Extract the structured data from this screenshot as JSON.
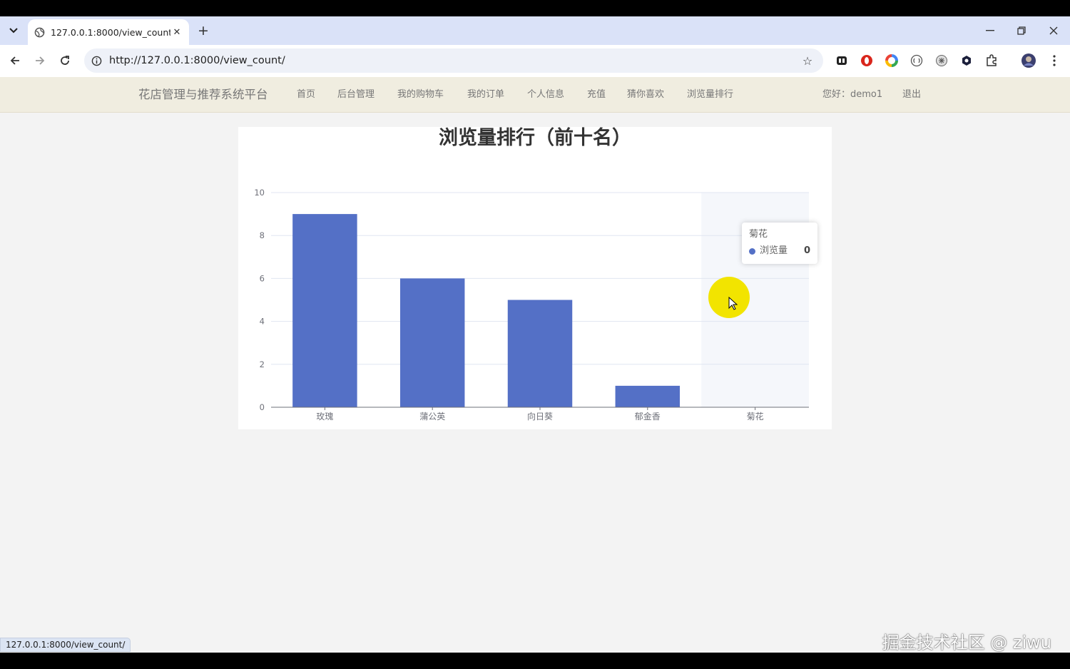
{
  "browser": {
    "tab_title": "127.0.0.1:8000/view_count/",
    "address": "http://127.0.0.1:8000/view_count/",
    "status_url": "127.0.0.1:8000/view_count/"
  },
  "site": {
    "brand": "花店管理与推荐系统平台",
    "nav": [
      "首页",
      "后台管理",
      "我的购物车",
      "我的订单",
      "个人信息",
      "充值",
      "猜你喜欢",
      "浏览量排行"
    ],
    "greeting": "您好：demo1",
    "logout": "退出"
  },
  "chart_data": {
    "type": "bar",
    "title": "浏览量排行（前十名）",
    "categories": [
      "玫瑰",
      "蒲公英",
      "向日葵",
      "郁金香",
      "菊花"
    ],
    "series": [
      {
        "name": "浏览量",
        "values": [
          9,
          6,
          5,
          1,
          0
        ]
      }
    ],
    "ylim": [
      0,
      10
    ],
    "yticks": [
      0,
      2,
      4,
      6,
      8,
      10
    ],
    "grid": true,
    "color": "#5470c6",
    "highlighted_category": "菊花"
  },
  "tooltip": {
    "name": "菊花",
    "series": "浏览量",
    "value": "0"
  },
  "watermark": "掘金技术社区 @ ziwu"
}
